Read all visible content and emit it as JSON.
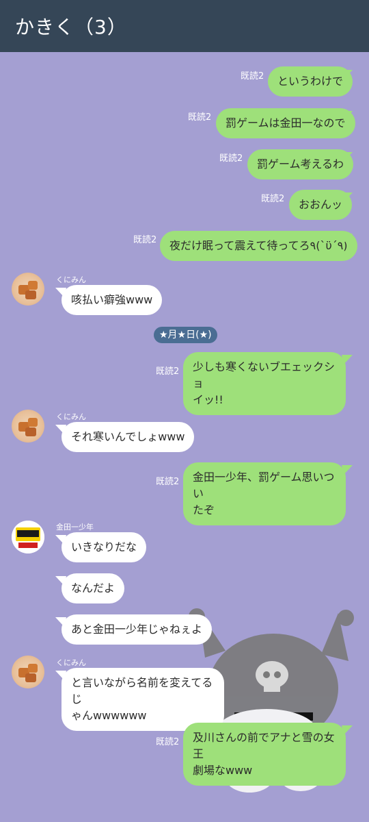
{
  "header": {
    "title": "かきく（3）"
  },
  "date_divider": "★月★日(★)",
  "messages": [
    {
      "dir": "out",
      "read": "既読2",
      "text": "というわけで"
    },
    {
      "dir": "out",
      "read": "既読2",
      "text": "罰ゲームは金田一なので"
    },
    {
      "dir": "out",
      "read": "既読2",
      "text": "罰ゲーム考えるわ"
    },
    {
      "dir": "out",
      "read": "既読2",
      "text": "おおんッ"
    },
    {
      "dir": "out",
      "read": "既読2",
      "text": "夜だけ眠って震えて待ってろ٩(`ϋ´٩)"
    },
    {
      "dir": "in",
      "sender": "くにみん",
      "text": "咳払い癖強www"
    },
    {
      "dir": "out",
      "read": "既読2",
      "text": "少しも寒くないブエェックショ\nイッ!!"
    },
    {
      "dir": "in",
      "sender": "くにみん",
      "text": "それ寒いんでしょwww"
    },
    {
      "dir": "out",
      "read": "既読2",
      "text": "金田一少年、罰ゲーム思いつい\nたぞ"
    },
    {
      "dir": "in",
      "sender": "金田一少年",
      "text": "いきなりだな"
    },
    {
      "dir": "in",
      "text": "なんだよ"
    },
    {
      "dir": "in",
      "text": "あと金田一少年じゃねぇよ"
    },
    {
      "dir": "in",
      "sender": "くにみん",
      "text": "と言いながら名前を変えてるじ\nゃんwwwwww"
    },
    {
      "dir": "out",
      "read": "既読2",
      "text": "及川さんの前でアナと雪の女王\n劇場なwww"
    }
  ],
  "colors": {
    "background": "#a49fd2",
    "header": "#354657",
    "outgoing_bubble": "#9ee07a",
    "incoming_bubble": "#ffffff",
    "date_chip": "#4a6d93"
  },
  "icons": [
    "caramel-avatar-icon",
    "kindaichi-avatar-icon",
    "wallpaper-character-illustration"
  ]
}
